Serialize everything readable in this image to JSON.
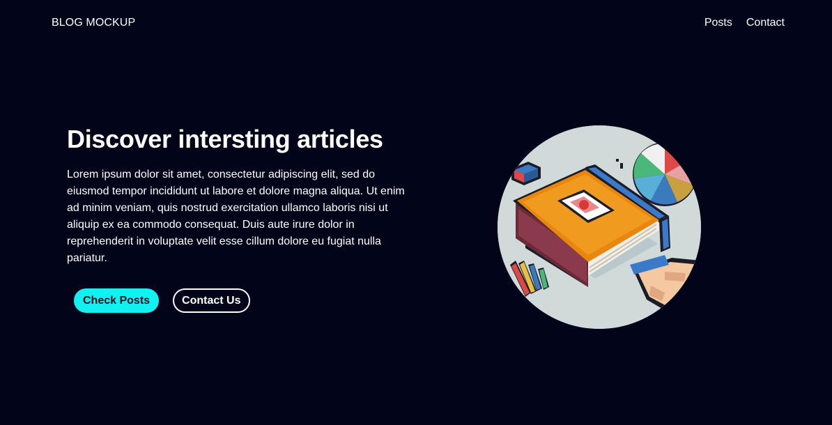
{
  "navbar": {
    "brand": "BLOG MOCKUP",
    "links": [
      "Posts",
      "Contact"
    ]
  },
  "hero": {
    "title": "Discover intersting articles",
    "body": "Lorem ipsum dolor sit amet, consectetur adipiscing elit, sed do eiusmod tempor incididunt ut labore et dolore magna aliqua. Ut enim ad minim veniam, quis nostrud exercitation ullamco laboris nisi ut aliquip ex ea commodo consequat. Duis aute irure dolor in reprehenderit in voluptate velit esse cillum dolore eu fugiat nulla pariatur.",
    "primary_button": "Check Posts",
    "secondary_button": "Contact Us",
    "image_alt": "pixel-art book illustration"
  },
  "colors": {
    "background": "#02041a",
    "accent": "#13f0f2",
    "text": "#ffffff"
  }
}
